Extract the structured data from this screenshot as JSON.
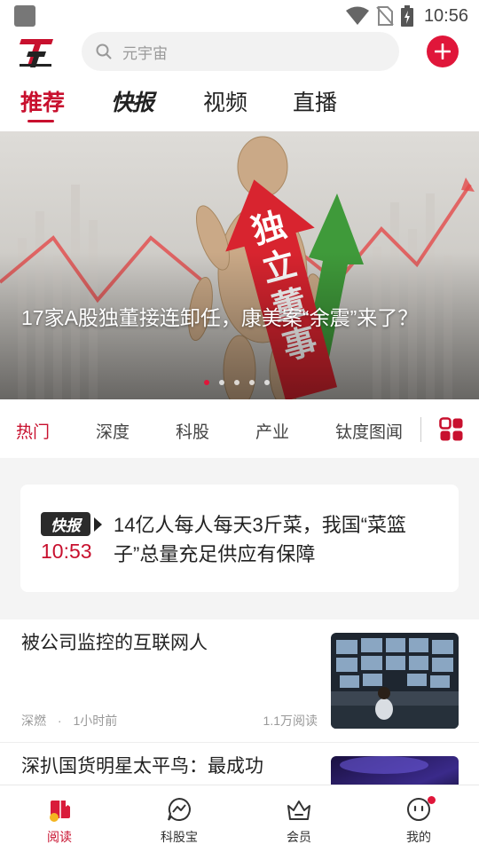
{
  "status_bar": {
    "time": "10:56"
  },
  "header": {
    "logo": "TT",
    "search_placeholder": "元宇宙"
  },
  "top_tabs": [
    {
      "label": "推荐",
      "active": true
    },
    {
      "label": "快报",
      "active": false
    },
    {
      "label": "视频",
      "active": false
    },
    {
      "label": "直播",
      "active": false
    }
  ],
  "banner": {
    "title": "17家A股独董接连卸任，康美案“余震”来了？",
    "sign_text": "独立董事",
    "slide_count": 5,
    "active_slide": 1
  },
  "category_tabs": [
    {
      "label": "热门",
      "active": true
    },
    {
      "label": "深度",
      "active": false
    },
    {
      "label": "科股",
      "active": false
    },
    {
      "label": "产业",
      "active": false
    },
    {
      "label": "钛度图闻",
      "active": false
    }
  ],
  "flash_news": {
    "badge": "快报",
    "time": "10:53",
    "text": "14亿人每人每天3斤菜，我国“菜篮子”总量充足供应有保障"
  },
  "news": [
    {
      "title": "被公司监控的互联网人",
      "source": "深燃",
      "time": "1小时前",
      "reads": "1.1万阅读"
    },
    {
      "title": "深扒国货明星太平鸟：最成功"
    }
  ],
  "bottom_nav": [
    {
      "label": "阅读",
      "icon": "book-icon",
      "active": true
    },
    {
      "label": "科股宝",
      "icon": "chat-chart-icon",
      "active": false
    },
    {
      "label": "会员",
      "icon": "crown-icon",
      "active": false
    },
    {
      "label": "我的",
      "icon": "profile-face-icon",
      "active": false,
      "badge": true
    }
  ],
  "colors": {
    "accent": "#c8102e",
    "button_red": "#e0163a"
  }
}
